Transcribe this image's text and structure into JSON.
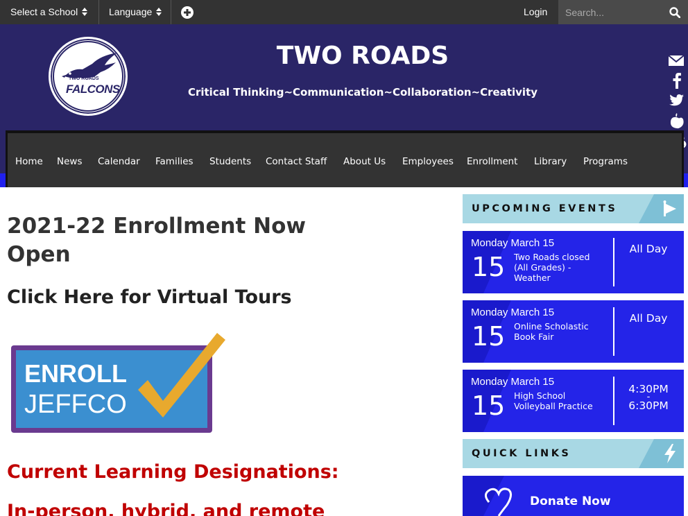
{
  "topbar": {
    "select_school": "Select a School",
    "language": "Language",
    "login": "Login",
    "search_placeholder": "Search..."
  },
  "header": {
    "school_name": "TWO ROADS",
    "tagline": "Critical Thinking~Communication~Collaboration~Creativity",
    "logo_text_top": "TWO ROADS",
    "logo_text_main": "FALCONS"
  },
  "nav": {
    "items": [
      {
        "label": "Home"
      },
      {
        "label": "News"
      },
      {
        "label": "Calendar"
      },
      {
        "label": "Families"
      },
      {
        "label": "Students"
      },
      {
        "label": "Contact Staff"
      },
      {
        "label": "About Us"
      },
      {
        "label": "Employees"
      },
      {
        "label": "Enrollment"
      },
      {
        "label": "Library"
      },
      {
        "label": "Programs"
      }
    ]
  },
  "main": {
    "heading": "2021-22 Enrollment Now Open",
    "virtual_tours": "Click Here for Virtual Tours",
    "enroll_logo_line1": "ENROLL",
    "enroll_logo_line2": "JEFFCO",
    "designations_heading": "Current Learning Designations:",
    "designations_sub": "In-person, hybrid, and remote"
  },
  "sidebar": {
    "upcoming_title": "UPCOMING EVENTS",
    "events": [
      {
        "date": "Monday March 15",
        "day": "15",
        "title": "Two Roads closed (All Grades) - Weather",
        "time": "All Day"
      },
      {
        "date": "Monday March 15",
        "day": "15",
        "title": "Online Scholastic Book Fair",
        "time": "All Day"
      },
      {
        "date": "Monday March 15",
        "day": "15",
        "title": "High School Volleyball Practice",
        "time_start": "4:30PM",
        "time_sep": "-",
        "time_end": "6:30PM"
      }
    ],
    "quick_links_title": "QUICK LINKS",
    "donate_label": "Donate Now"
  },
  "colors": {
    "header_bg": "#2a2567",
    "nav_bg": "#333333",
    "event_bg": "#2424e8",
    "section_head_bg": "#a8d8e4",
    "alert_red": "#c00000"
  },
  "icons": {
    "social": [
      "email-icon",
      "facebook-icon",
      "twitter-icon",
      "peachjar-icon",
      "donate-heart-icon"
    ]
  }
}
